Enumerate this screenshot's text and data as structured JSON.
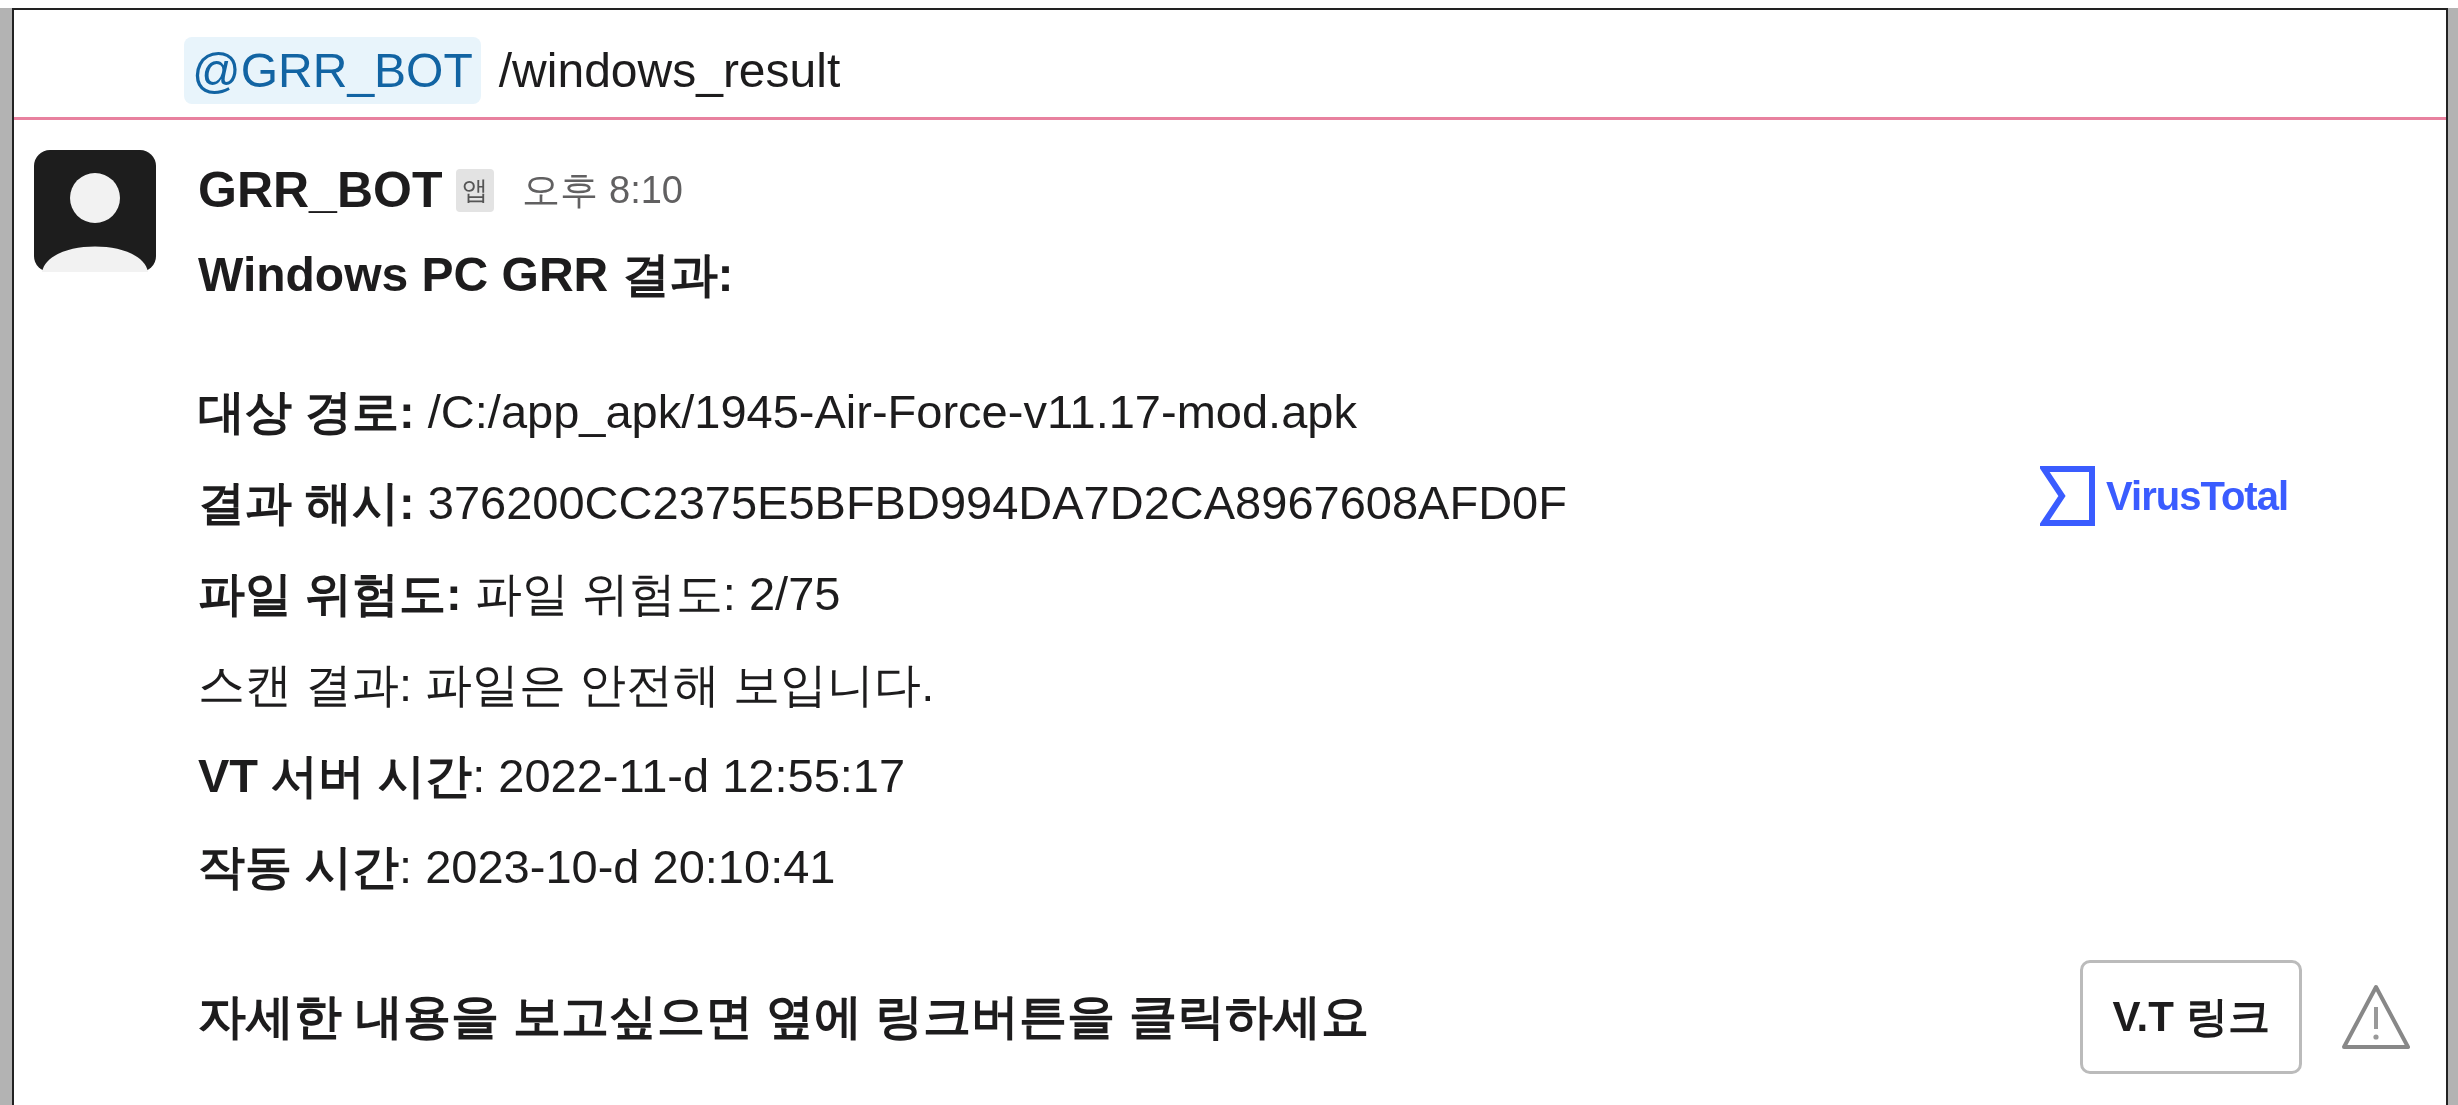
{
  "command": {
    "mention": "@GRR_BOT",
    "text": "/windows_result"
  },
  "message": {
    "sender": "GRR_BOT",
    "badge": "앱",
    "time": "오후 8:10",
    "title": "Windows PC GRR 결과:",
    "fields": [
      "**대상 경로:** /C:/app_apk/1945-Air-Force-v11.17-mod.apk",
      "**결과 해시:** 376200CC2375E5BFBD994DA7D2CA8967608AFD0F",
      "**파일 위험도:** 파일 위험도: 2/75",
      "스캔 결과: 파일은 안전해 보입니다.",
      "**VT 서버 시간**: 2022-11-d 12:55:17",
      "**작동 시간**: 2023-10-d 20:10:41"
    ],
    "logo_text": "VirusTotal",
    "footer": "자세한 내용을 보고싶으면 옆에 링크버튼을 클릭하세요",
    "button": "V.T 링크"
  }
}
